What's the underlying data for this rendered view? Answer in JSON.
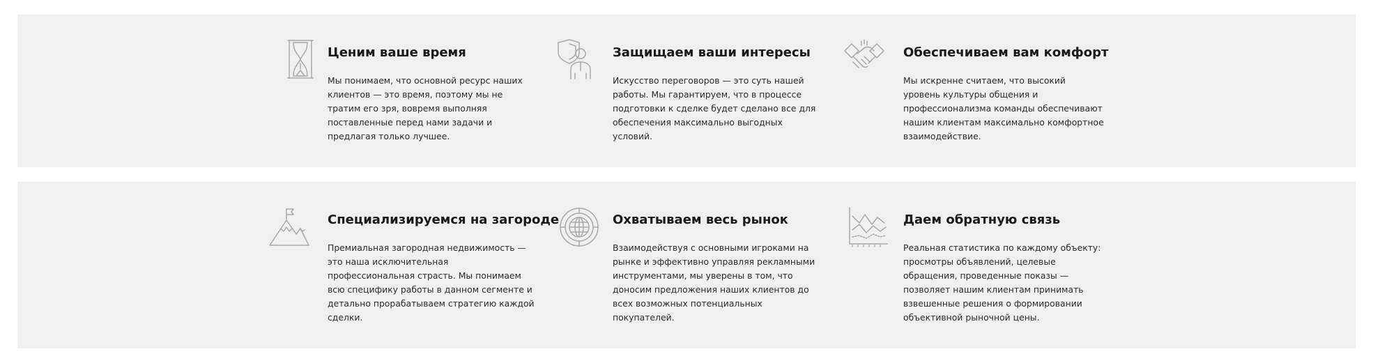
{
  "colors": {
    "band_background": "#f0f0f0",
    "icon_stroke": "#a9a9a9",
    "heading": "#1a1a1a",
    "body_text": "#2b2b2b"
  },
  "rows": [
    {
      "features": [
        {
          "icon": "hourglass-icon",
          "title": "Ценим ваше время",
          "text": "Мы понимаем, что основной ресурс наших клиентов — это время, поэтому мы не тратим его зря, вовремя выполняя поставленные перед нами задачи и предлагая только лучшее."
        },
        {
          "icon": "shield-person-icon",
          "title": "Защищаем ваши интересы",
          "text": "Искусство переговоров — это суть нашей работы. Мы гарантируем, что в процессе подготовки к сделке будет сделано все для обеспечения максимально выгодных условий."
        },
        {
          "icon": "handshake-icon",
          "title": "Обеспечиваем вам комфорт",
          "text": "Мы искренне считаем, что высокий уровень культуры общения и профессионализма команды обеспечивают нашим клиентам максимально комфортное взаимодействие."
        }
      ]
    },
    {
      "features": [
        {
          "icon": "mountain-flag-icon",
          "title": "Специализируемся на загороде",
          "text": "Премиальная загородная недвижимость — это наша исключительная профессиональная страсть. Мы понимаем всю специфику работы в данном сегменте и детально прорабатываем стратегию каждой сделки."
        },
        {
          "icon": "globe-icon",
          "title": "Охватываем весь рынок",
          "text": "Взаимодействуя с основными игроками на рынке и эффективно управляя рекламными инструментами, мы уверены в том, что доносим предложения наших клиентов до всех возможных потенциальных покупателей."
        },
        {
          "icon": "line-chart-icon",
          "title": "Даем обратную связь",
          "text": "Реальная статистика по каждому объекту: просмотры объявлений, целевые обращения, проведенные показы — позволяет нашим клиентам принимать взвешенные решения о формировании объективной рыночной цены."
        }
      ]
    }
  ]
}
